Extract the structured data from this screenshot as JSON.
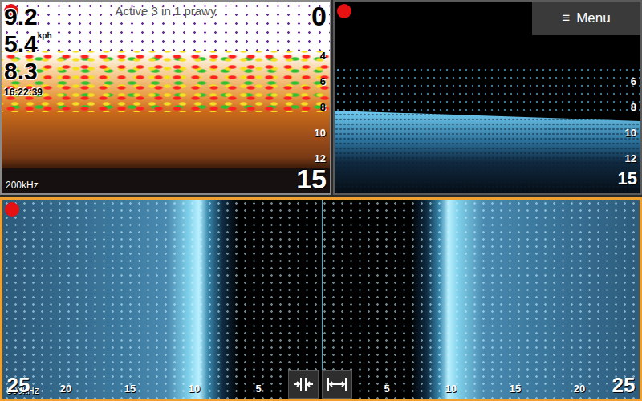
{
  "sonar_panel": {
    "title": "Active 3 in 1 prawy",
    "recording": true,
    "readings": [
      {
        "value": "9.2"
      },
      {
        "value": "5.4",
        "unit": "kph"
      },
      {
        "value": "8.3"
      }
    ],
    "time": "16:22:39",
    "frequency": "200kHz",
    "range_top": "0",
    "range_bottom": "15",
    "depth_ticks": [
      "4",
      "6",
      "8",
      "10",
      "12"
    ]
  },
  "downscan_panel": {
    "recording": true,
    "range_bottom": "15",
    "depth_ticks": [
      "6",
      "8",
      "10",
      "12"
    ]
  },
  "menu": {
    "icon": "≡",
    "label": "Menu"
  },
  "sidescan_panel": {
    "recording": true,
    "frequency": "800kHz",
    "active": true,
    "range_left": "25",
    "range_right": "25",
    "scale": [
      "20",
      "15",
      "10",
      "5",
      "5",
      "10",
      "15",
      "20"
    ]
  }
}
